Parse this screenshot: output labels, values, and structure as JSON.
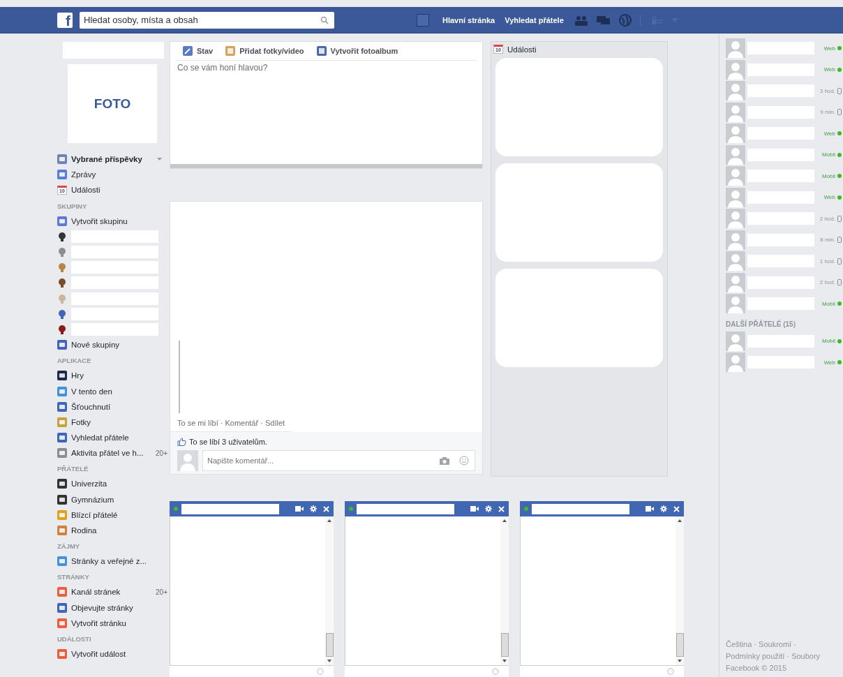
{
  "topbar": {
    "logo": "f",
    "search": {
      "placeholder": "Hledat osoby, místa a obsah"
    },
    "links": [
      "Hlavní stránka",
      "Vyhledat přátele"
    ]
  },
  "profile": {
    "photo_label": "FOTO"
  },
  "sidebar": [
    {
      "kind": "item",
      "label": "Vybrané příspěvky",
      "bold": true,
      "dropdown": true
    },
    {
      "kind": "item",
      "label": "Zprávy"
    },
    {
      "kind": "item",
      "label": "Události",
      "icon_text": "10"
    },
    {
      "kind": "heading",
      "label": "SKUPINY"
    },
    {
      "kind": "item",
      "label": "Vytvořit skupinu"
    },
    {
      "kind": "blank"
    },
    {
      "kind": "blank"
    },
    {
      "kind": "blank"
    },
    {
      "kind": "blank"
    },
    {
      "kind": "blank"
    },
    {
      "kind": "blank"
    },
    {
      "kind": "blank"
    },
    {
      "kind": "item",
      "label": "Nové skupiny"
    },
    {
      "kind": "heading",
      "label": "APLIKACE"
    },
    {
      "kind": "item",
      "label": "Hry"
    },
    {
      "kind": "item",
      "label": "V tento den"
    },
    {
      "kind": "item",
      "label": "Šťouchnutí"
    },
    {
      "kind": "item",
      "label": "Fotky"
    },
    {
      "kind": "item",
      "label": "Vyhledat přátele"
    },
    {
      "kind": "item",
      "label": "Aktivita přátel ve h...",
      "count": "20+"
    },
    {
      "kind": "heading",
      "label": "PŘÁTELÉ"
    },
    {
      "kind": "item",
      "label": "Univerzita"
    },
    {
      "kind": "item",
      "label": "Gymnázium"
    },
    {
      "kind": "item",
      "label": "Blízcí přátelé"
    },
    {
      "kind": "item",
      "label": "Rodina"
    },
    {
      "kind": "heading",
      "label": "ZÁJMY"
    },
    {
      "kind": "item",
      "label": "Stránky a veřejné z..."
    },
    {
      "kind": "heading",
      "label": "STRÁNKY"
    },
    {
      "kind": "item",
      "label": "Kanál stránek",
      "count": "20+"
    },
    {
      "kind": "item",
      "label": "Objevujte stránky"
    },
    {
      "kind": "item",
      "label": "Vytvořit stránku"
    },
    {
      "kind": "heading",
      "label": "UDÁLOSTI"
    },
    {
      "kind": "item",
      "label": "Vytvořit událost"
    }
  ],
  "composer": {
    "tabs": [
      {
        "label": "Stav"
      },
      {
        "label": "Přidat fotky/video"
      },
      {
        "label": "Vytvořit fotoalbum"
      }
    ],
    "placeholder": "Co se vám honí hlavou?"
  },
  "post": {
    "actions": "To se mi líbí · Komentář · Sdílet",
    "likes": "To se líbí 3 uživatelům.",
    "comment_placeholder": "Napište komentář..."
  },
  "events": {
    "title": "Události",
    "icon_text": "10"
  },
  "chats": [
    {
      "online": true
    },
    {
      "online": true
    },
    {
      "online": true
    }
  ],
  "friends": [
    {
      "status": "Web",
      "online": true
    },
    {
      "status": "Web",
      "online": true
    },
    {
      "status": "3 hod.",
      "online": false
    },
    {
      "status": "9 min.",
      "online": false
    },
    {
      "status": "Web",
      "online": true
    },
    {
      "status": "Mobil",
      "online": true
    },
    {
      "status": "Mobil",
      "online": true
    },
    {
      "status": "Web",
      "online": true
    },
    {
      "status": "2 hod.",
      "online": false
    },
    {
      "status": "8 min.",
      "online": false
    },
    {
      "status": "1 hod.",
      "online": false
    },
    {
      "status": "2 hod.",
      "online": false
    },
    {
      "status": "Mobil",
      "online": true
    }
  ],
  "more_friends": {
    "title": "DALŠÍ PŘÁTELÉ (15)",
    "items": [
      {
        "status": "Mobil",
        "online": true
      },
      {
        "status": "Web",
        "online": true
      }
    ]
  },
  "footer": [
    "Čeština · Soukromí ·",
    "Podmínky použití · Soubory",
    "Facebook © 2015"
  ]
}
